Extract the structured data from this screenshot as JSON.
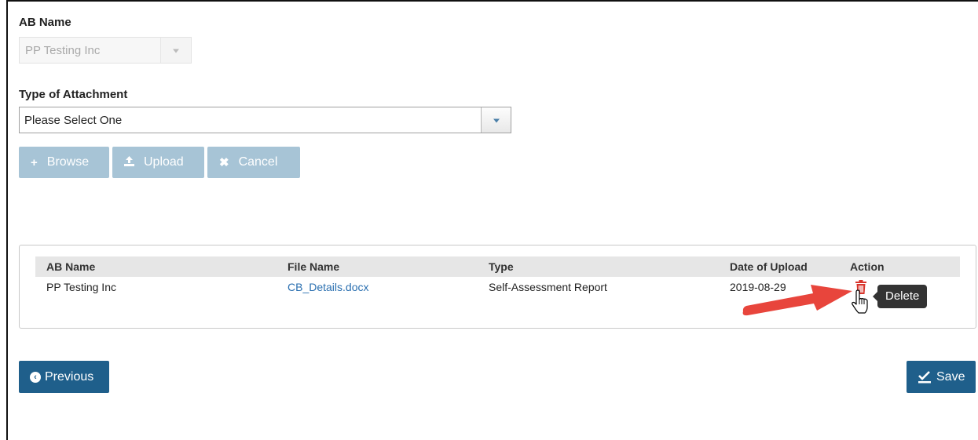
{
  "form": {
    "ab_name_label": "AB Name",
    "ab_name_value": "PP Testing Inc",
    "attachment_type_label": "Type of Attachment",
    "attachment_type_value": "Please Select One"
  },
  "toolbar": {
    "browse_label": "Browse",
    "upload_label": "Upload",
    "cancel_label": "Cancel",
    "button_color": "#a7c4d6"
  },
  "table": {
    "columns": [
      "AB Name",
      "File Name",
      "Type",
      "Date of Upload",
      "Action"
    ],
    "rows": [
      {
        "ab_name": "PP Testing Inc",
        "file_name": "CB_Details.docx",
        "type": "Self-Assessment Report",
        "date": "2019-08-29",
        "action_icon": "trash-icon"
      }
    ],
    "tooltip": "Delete"
  },
  "navigation": {
    "previous_label": "Previous",
    "save_label": "Save",
    "button_color": "#1f5f8b"
  },
  "annotation": {
    "arrow_color": "#e8453c"
  }
}
